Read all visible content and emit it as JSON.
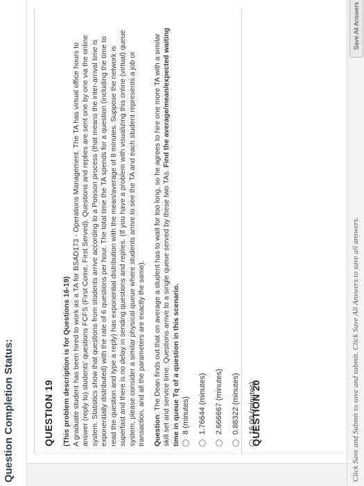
{
  "header": {
    "status_title": "Question Completion Status:"
  },
  "question19": {
    "heading": "QUESTION 19",
    "desc_title": "(This problem description is for Questions 16-19)",
    "desc_text": "A graduate student has been hired to work as a TA for BSAD173 - Operations Management. The TA has virtual office hours to answer (reply to) students' questions FCFS (First Come, First Served). Questions and replies are sent one by one via the online system. Statistics show that questions from students arrive according to a Poisson process (that means the inter-arrival time is exponentially distributed) with the rate of 6 questions per hour. The total time the TA spends for a question (including the time to read the question and type a reply) has exponential distribution with the mean/average of 8 minutes. Suppose the network is superfast and there is no delay in sending questions and replies. (If you have a problem with visualizing this online (virtual) queue system, please consider a similar physical queue where students arrive to see the TA and each student represents a job or transaction, and all the parameters are exactly the same).",
    "prompt_label": "Question",
    "prompt_text": ": The Dean finds out that on average a student has to wait for too long, so he agrees to hire one more TA with a similar skill set and service time. Questions arrive to a single queue served by these two TAs. ",
    "prompt_emphasis": "Find the average/mean/expected waiting time in queue Tq of a question in this scenario.",
    "options": [
      "8 (minutes)",
      "1.76644 (minutes)",
      "2.666667 (minutes)",
      "0.88322 (minutes)",
      "16.00 (minutes)"
    ]
  },
  "question20": {
    "heading": "QUESTION 20"
  },
  "footer": {
    "hint": "Click Save and Submit to save and submit. Click Save All Answers to save all answers.",
    "save_all_label": "Save All Answers"
  }
}
